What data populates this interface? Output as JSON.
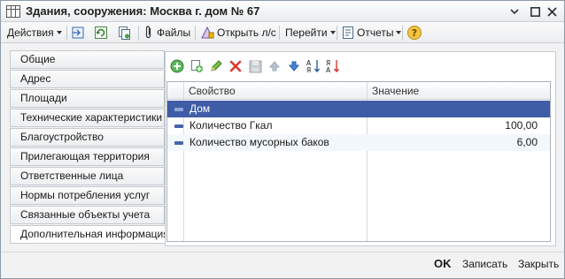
{
  "window": {
    "title": "Здания, сооружения: Москва г. дом № 67",
    "controls": {
      "menu": "⌄",
      "close": "✕",
      "maximize": "□"
    }
  },
  "toolbar": {
    "actions": "Действия",
    "files": "Файлы",
    "open_account": "Открыть л/с",
    "goto": "Перейти",
    "reports": "Отчеты"
  },
  "tabs": [
    {
      "label": "Общие"
    },
    {
      "label": "Адрес"
    },
    {
      "label": "Площади"
    },
    {
      "label": "Технические характеристики"
    },
    {
      "label": "Благоустройство"
    },
    {
      "label": "Прилегающая территория"
    },
    {
      "label": "Ответственные лица"
    },
    {
      "label": "Нормы потребления услуг"
    },
    {
      "label": "Связанные объекты учета"
    },
    {
      "label": "Дополнительная информация"
    }
  ],
  "active_tab_index": 9,
  "grid": {
    "columns": {
      "property": "Свойство",
      "value": "Значение"
    },
    "rows": [
      {
        "property": "Дом",
        "value": ""
      },
      {
        "property": "Количество Гкал",
        "value": "100,00"
      },
      {
        "property": "Количество мусорных баков",
        "value": "6,00"
      }
    ],
    "selected_row_index": 0
  },
  "footer": {
    "ok": "OK",
    "save": "Записать",
    "close": "Закрыть"
  },
  "colors": {
    "selection": "#3f5da6",
    "row_marker": "#4466aa",
    "accent_icon": "#f2b705"
  }
}
